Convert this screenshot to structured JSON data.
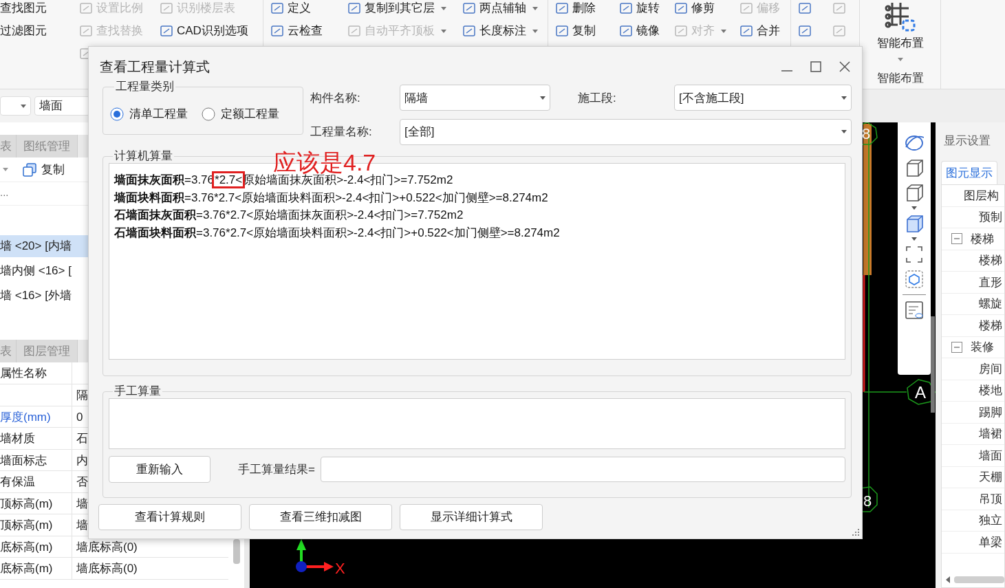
{
  "ribbon": {
    "columns": [
      {
        "items": [
          {
            "kind": "text",
            "label": "查找图元",
            "disabled": false
          },
          {
            "kind": "text",
            "label": "过滤图元",
            "disabled": false
          }
        ]
      },
      {
        "items": [
          {
            "kind": "tool",
            "label": "设置比例",
            "disabled": true
          },
          {
            "kind": "tool",
            "label": "查找替换",
            "disabled": true
          },
          {
            "kind": "icon",
            "disabled": true
          }
        ]
      },
      {
        "items": [
          {
            "kind": "tool",
            "label": "识别楼层表",
            "disabled": true
          },
          {
            "kind": "tool",
            "label": "CAD识别选项",
            "disabled": false
          }
        ]
      },
      {
        "items": [
          {
            "kind": "tool",
            "label": "定义",
            "disabled": false
          },
          {
            "kind": "tool",
            "label": "云检查",
            "disabled": false
          }
        ]
      },
      {
        "items": [
          {
            "kind": "tool",
            "label": "复制到其它层",
            "disabled": false,
            "dropdown": true
          },
          {
            "kind": "tool",
            "label": "自动平齐顶板",
            "disabled": true,
            "dropdown": true
          }
        ]
      },
      {
        "items": [
          {
            "kind": "tool",
            "label": "两点辅轴",
            "disabled": false,
            "dropdown": true
          },
          {
            "kind": "tool",
            "label": "长度标注",
            "disabled": false,
            "dropdown": true
          }
        ]
      },
      {
        "items": [
          {
            "kind": "tool",
            "label": "删除",
            "disabled": false
          },
          {
            "kind": "tool",
            "label": "复制",
            "disabled": false
          }
        ]
      },
      {
        "items": [
          {
            "kind": "tool",
            "label": "旋转",
            "disabled": false
          },
          {
            "kind": "tool",
            "label": "镜像",
            "disabled": false
          }
        ]
      },
      {
        "items": [
          {
            "kind": "tool",
            "label": "修剪",
            "disabled": false
          },
          {
            "kind": "tool",
            "label": "对齐",
            "disabled": true,
            "dropdown": true
          }
        ]
      },
      {
        "items": [
          {
            "kind": "tool",
            "label": "偏移",
            "disabled": true
          },
          {
            "kind": "tool",
            "label": "合并",
            "disabled": false
          }
        ]
      },
      {
        "items": [
          {
            "kind": "icon",
            "disabled": false
          },
          {
            "kind": "icon",
            "disabled": false
          }
        ]
      },
      {
        "items": [
          {
            "kind": "icon",
            "disabled": true
          },
          {
            "kind": "icon",
            "disabled": true
          }
        ]
      }
    ],
    "smart_button": {
      "label": "智能布置"
    },
    "group_label": "智能布置"
  },
  "left_panel": {
    "filter_value": "墙面",
    "top_tabs": [
      {
        "label": "表",
        "selected": false
      },
      {
        "label": "图纸管理",
        "selected": false
      }
    ],
    "copy_label": "复制",
    "search_text": "...",
    "components": [
      {
        "label": "墙 <20> [内墙",
        "selected": true
      },
      {
        "label": "墙内侧 <16> [",
        "selected": false
      },
      {
        "label": "墙 <16> [外墙",
        "selected": false
      }
    ],
    "bottom_tabs": [
      {
        "label": "表",
        "selected": false
      },
      {
        "label": "图层管理",
        "selected": false
      }
    ],
    "properties": {
      "header": "属性名称",
      "rows": [
        {
          "value": "隔"
        },
        {
          "name": "厚度(mm)",
          "value": "0",
          "highlighted": true
        },
        {
          "name": "墙材质",
          "value": "石",
          "highlighted": false
        },
        {
          "name": "墙面标志",
          "value": "内",
          "highlighted": false
        },
        {
          "name": "有保温",
          "value": "否",
          "highlighted": false
        },
        {
          "name": "顶标高(m)",
          "value": "墙",
          "highlighted": false
        },
        {
          "name": "顶标高(m)",
          "value": "墙",
          "highlighted": false
        },
        {
          "name": "底标高(m)",
          "value": "墙底标高(0)",
          "highlighted": false
        },
        {
          "name": "底标高(m)",
          "value": "墙底标高(0)",
          "highlighted": false
        }
      ]
    }
  },
  "canvas": {
    "axis_labels": [
      "8",
      "A",
      "8"
    ],
    "x_axis_label": "X"
  },
  "display_settings": {
    "title": "显示设置",
    "tabs": [
      {
        "label": "图元显示",
        "selected": true
      }
    ],
    "tree": [
      {
        "label": "图层构",
        "children": [
          {
            "label": "预制"
          }
        ]
      },
      {
        "label": "楼梯",
        "expanded": true,
        "children": [
          {
            "label": "楼梯"
          },
          {
            "label": "直形"
          },
          {
            "label": "螺旋"
          },
          {
            "label": "楼梯"
          }
        ]
      },
      {
        "label": "装修",
        "expanded": true,
        "children": [
          {
            "label": "房间"
          },
          {
            "label": "楼地"
          },
          {
            "label": "踢脚"
          },
          {
            "label": "墙裙"
          },
          {
            "label": "墙面"
          },
          {
            "label": "天棚"
          },
          {
            "label": "吊顶"
          },
          {
            "label": "独立"
          },
          {
            "label": "单梁"
          }
        ]
      }
    ]
  },
  "dialog": {
    "title": "查看工程量计算式",
    "quantity_type": {
      "legend": "工程量类别",
      "options": [
        {
          "label": "清单工程量",
          "selected": true
        },
        {
          "label": "定额工程量",
          "selected": false
        }
      ]
    },
    "fields": [
      {
        "label": "构件名称:",
        "value": "隔墙"
      },
      {
        "label": "施工段:",
        "value": "[不含施工段]"
      },
      {
        "label": "工程量名称:",
        "value": "[全部]"
      }
    ],
    "computed": {
      "legend": "计算机算量",
      "lines": [
        {
          "parts": [
            {
              "text": "**墙面抹灰面积**=3.76",
              "boxed": false
            },
            {
              "text": "*2.7<",
              "boxed": true
            },
            {
              "text": "原始墙面抹灰面积>-2.4<扣门>=7.752m2",
              "boxed": false
            }
          ]
        },
        {
          "parts": [
            {
              "text": "**墙面块料面积**=3.76*2.7<原始墙面块料面积>-2.4<扣门>+0.522<加门侧壁>=8.274m2",
              "boxed": false
            }
          ]
        },
        {
          "parts": [
            {
              "text": "**石墙面抹灰面积**=3.76*2.7<原始墙面抹灰面积>-2.4<扣门>=7.752m2",
              "boxed": false
            }
          ]
        },
        {
          "parts": [
            {
              "text": "**石墙面块料面积**=3.76*2.7<原始墙面块料面积>-2.4<扣门>+0.522<加门侧壁>=8.274m2",
              "boxed": false
            }
          ]
        }
      ]
    },
    "annotation": "应该是4.7",
    "manual": {
      "legend": "手工算量",
      "reenter_button": "重新输入",
      "result_label": "手工算量结果="
    },
    "buttons": [
      "查看计算规则",
      "查看三维扣减图",
      "显示详细计算式"
    ]
  }
}
